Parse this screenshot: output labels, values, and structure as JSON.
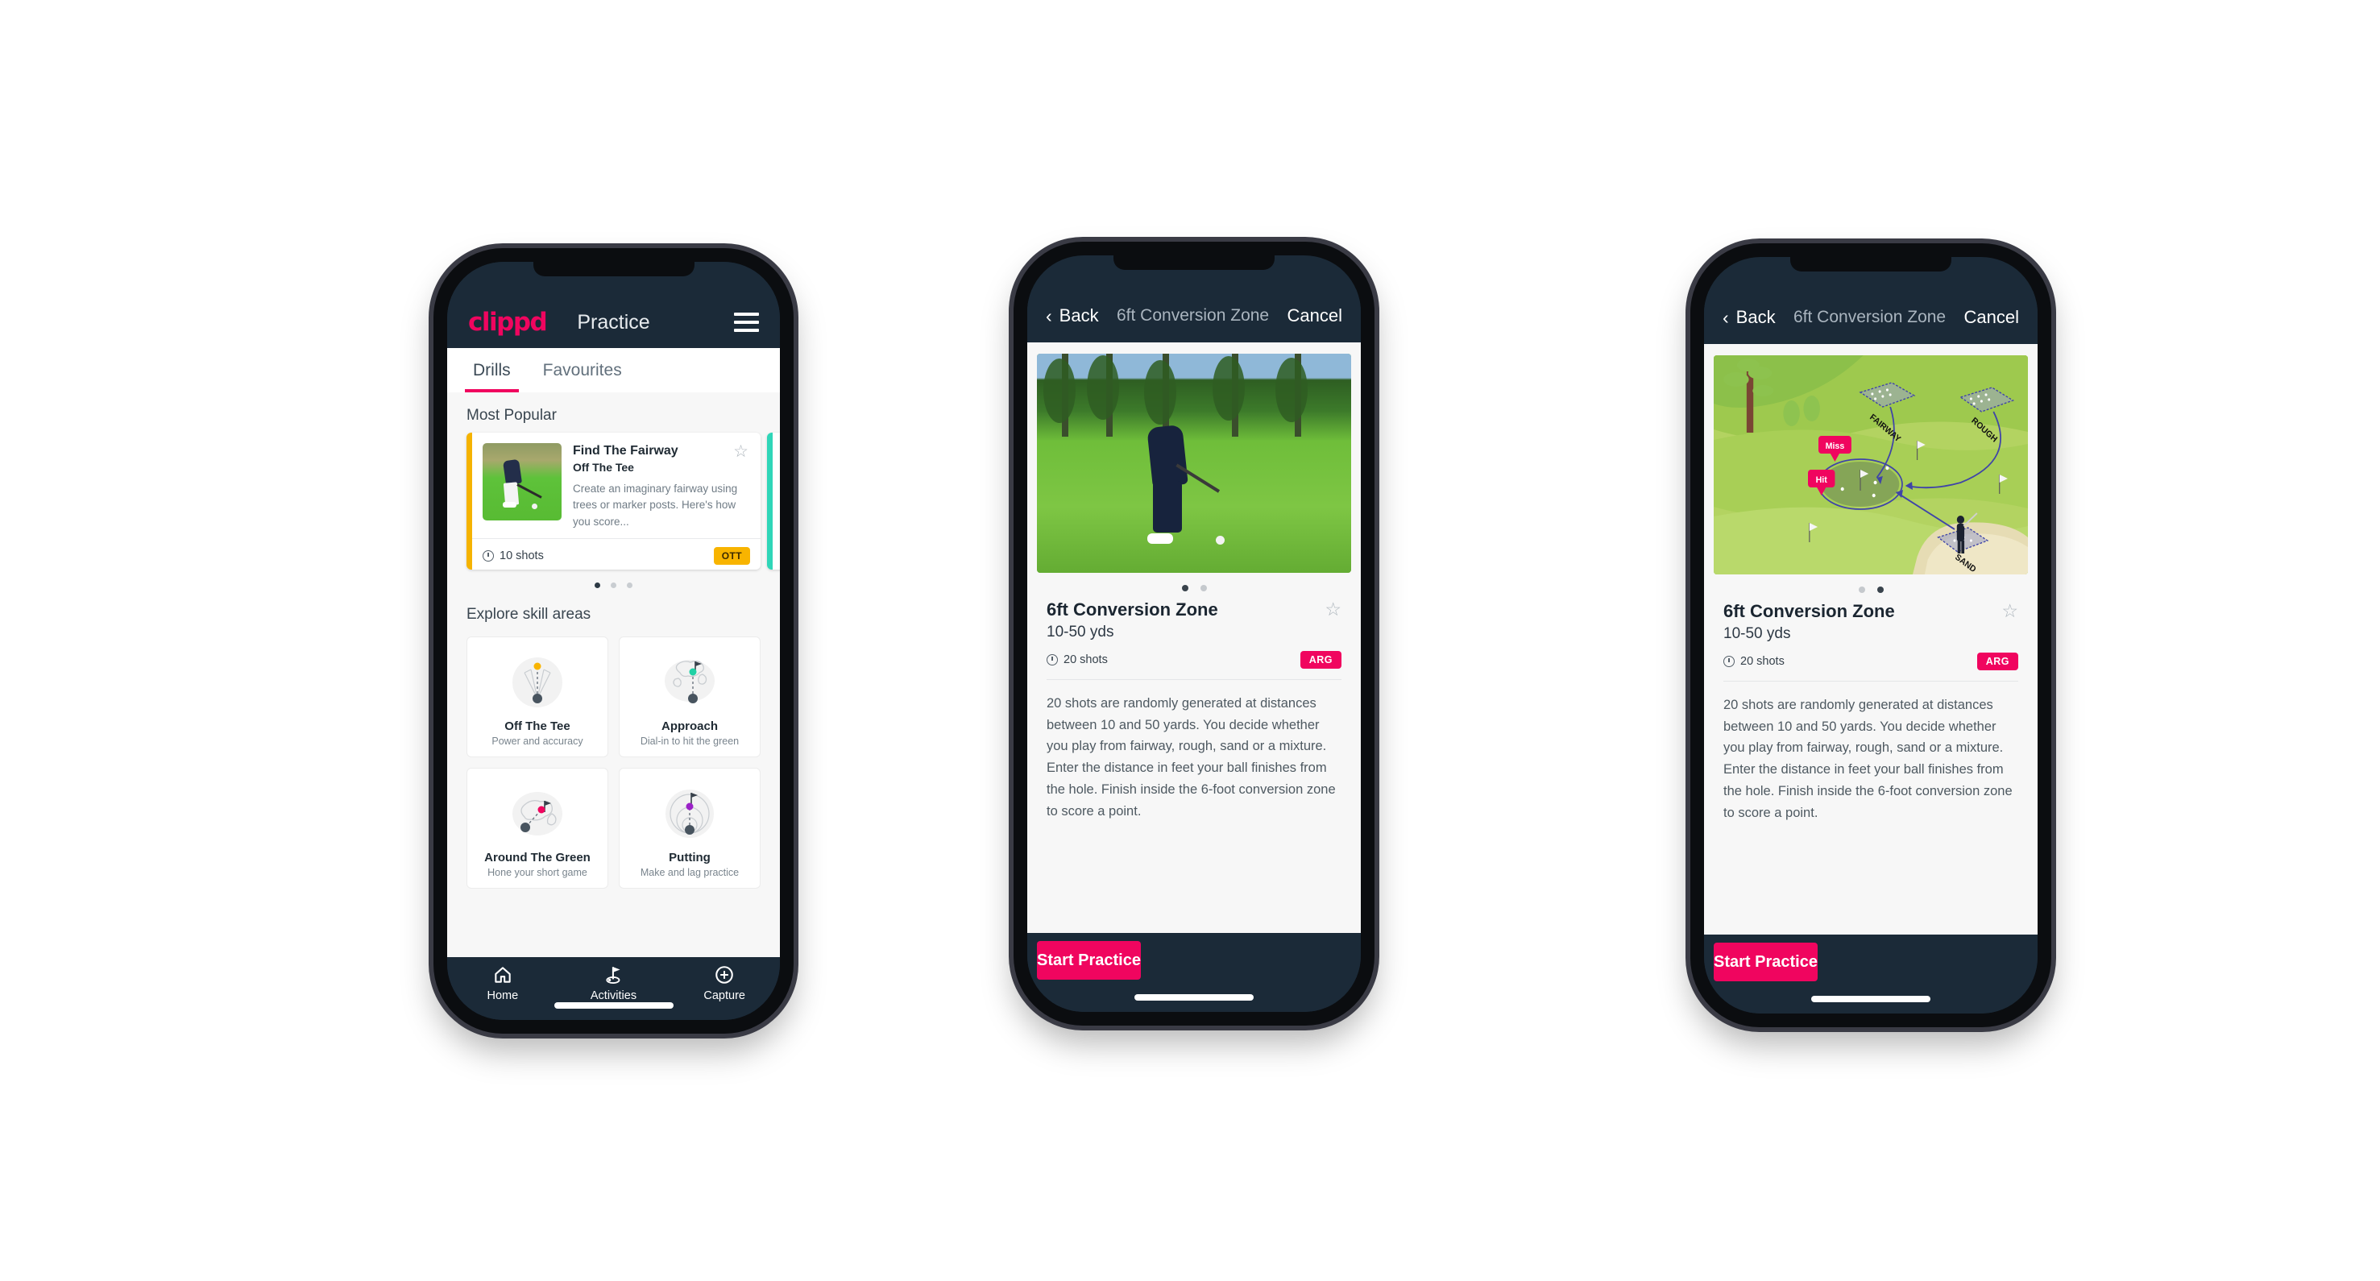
{
  "phone1": {
    "app_bar": {
      "logo": "clippd",
      "title": "Practice",
      "menu_icon": "hamburger-menu-icon"
    },
    "tabs": [
      {
        "label": "Drills",
        "active": true
      },
      {
        "label": "Favourites",
        "active": false
      }
    ],
    "sections": {
      "most_popular": "Most Popular",
      "explore": "Explore skill areas"
    },
    "featured_drill": {
      "name": "Find The Fairway",
      "skill": "Off The Tee",
      "description": "Create an imaginary fairway using trees or marker posts. Here's how you score...",
      "shots": "10 shots",
      "badge": "OTT",
      "badge_color": "#f8b400",
      "accent_color": "#f5b301",
      "next_card_accent": "#2fd6b8",
      "star_icon": "star-outline-icon",
      "clock_icon": "clock-icon"
    },
    "carousel_dots": {
      "count": 3,
      "active_index": 0
    },
    "skill_areas": [
      {
        "name": "Off The Tee",
        "subtitle": "Power and accuracy",
        "dot_color": "#f8b400",
        "icon": "tee-fan-icon"
      },
      {
        "name": "Approach",
        "subtitle": "Dial-in to hit the green",
        "dot_color": "#1fd1a5",
        "icon": "approach-green-icon"
      },
      {
        "name": "Around The Green",
        "subtitle": "Hone your short game",
        "dot_color": "#f0055f",
        "icon": "chip-green-icon"
      },
      {
        "name": "Putting",
        "subtitle": "Make and lag practice",
        "dot_color": "#9b21c7",
        "icon": "putting-rings-icon"
      }
    ],
    "bottom_nav": [
      {
        "label": "Home",
        "icon": "home-icon",
        "active": false
      },
      {
        "label": "Activities",
        "icon": "golf-flag-icon",
        "active": true
      },
      {
        "label": "Capture",
        "icon": "plus-circle-icon",
        "active": false
      }
    ]
  },
  "phone2": {
    "nav": {
      "back_label": "Back",
      "back_icon": "chevron-left-icon",
      "title": "6ft Conversion Zone",
      "cancel_label": "Cancel"
    },
    "media": {
      "type": "photo",
      "alt": "golfer-chipping-photo"
    },
    "carousel_dots": {
      "count": 2,
      "active_index": 0
    },
    "detail": {
      "title": "6ft Conversion Zone",
      "range": "10-50 yds",
      "shots": "20 shots",
      "badge": "ARG",
      "badge_color": "#f0055f",
      "star_icon": "star-outline-icon",
      "clock_icon": "clock-icon",
      "description": "20 shots are randomly generated at distances between 10 and 50 yards. You decide whether you play from fairway, rough, sand or a mixture. Enter the distance in feet your ball finishes from the hole. Finish inside the 6-foot conversion zone to score a point."
    },
    "cta": {
      "label": "Start Practice",
      "color": "#f0055f"
    }
  },
  "phone3": {
    "nav": {
      "back_label": "Back",
      "back_icon": "chevron-left-icon",
      "title": "6ft Conversion Zone",
      "cancel_label": "Cancel"
    },
    "media": {
      "type": "illustration",
      "alt": "golf-course-diagram",
      "labels": [
        "FAIRWAY",
        "ROUGH",
        "SAND"
      ],
      "markers": [
        {
          "text": "Miss",
          "color": "#f0055f"
        },
        {
          "text": "Hit",
          "color": "#f0055f"
        }
      ]
    },
    "carousel_dots": {
      "count": 2,
      "active_index": 1
    },
    "detail": {
      "title": "6ft Conversion Zone",
      "range": "10-50 yds",
      "shots": "20 shots",
      "badge": "ARG",
      "badge_color": "#f0055f",
      "star_icon": "star-outline-icon",
      "clock_icon": "clock-icon",
      "description": "20 shots are randomly generated at distances between 10 and 50 yards. You decide whether you play from fairway, rough, sand or a mixture. Enter the distance in feet your ball finishes from the hole. Finish inside the 6-foot conversion zone to score a point."
    },
    "cta": {
      "label": "Start Practice",
      "color": "#f0055f"
    }
  },
  "theme": {
    "header_bg": "#1b2a38",
    "page_bg": "#f7f7f7",
    "brand_pink": "#f0055f"
  }
}
